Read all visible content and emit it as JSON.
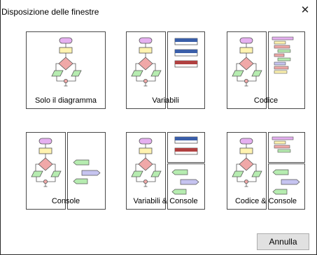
{
  "window": {
    "title": "Disposizione delle finestre",
    "close_icon": "close-icon"
  },
  "options": [
    {
      "label": "Solo il diagramma"
    },
    {
      "label": "Variabili"
    },
    {
      "label": "Codice"
    },
    {
      "label": "Console"
    },
    {
      "label": "Variabili & Console"
    },
    {
      "label": "Codice & Console"
    }
  ],
  "buttons": {
    "cancel": "Annulla"
  },
  "colors": {
    "start": "#e5b0f0",
    "process": "#fff3b0",
    "decision": "#f0a8a8",
    "io": "#b6ecb0",
    "var_blue": "#3a5ea8",
    "var_red": "#b04040",
    "console_purple": "#c6c4f0",
    "border": "#4a4a4a"
  }
}
